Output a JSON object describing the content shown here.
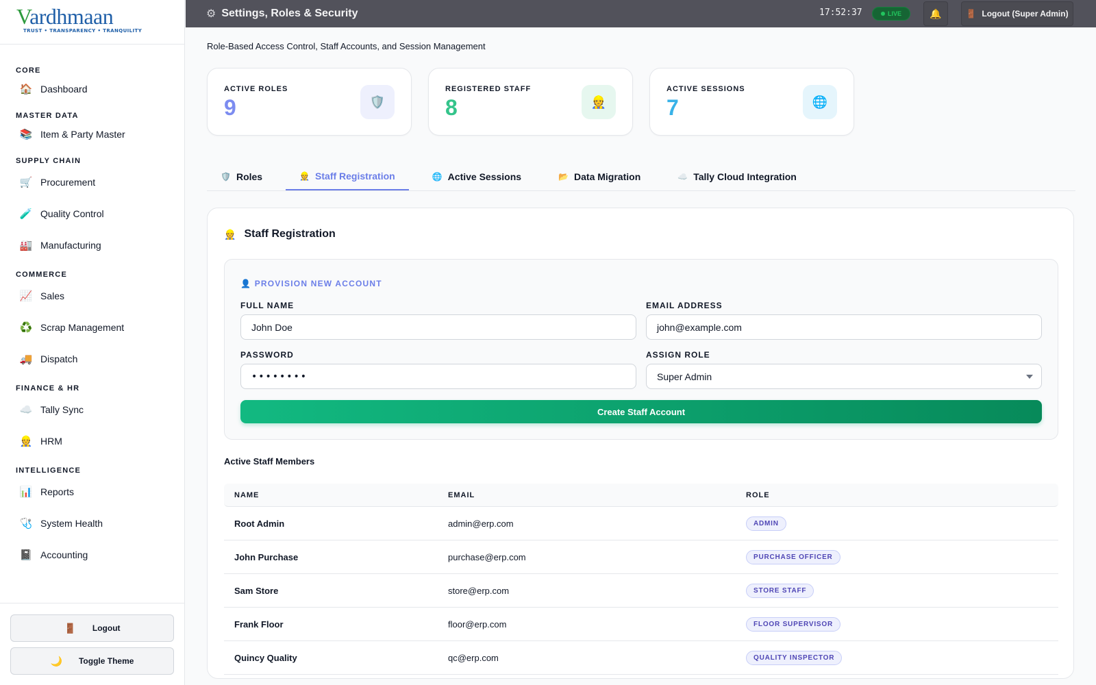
{
  "brand": {
    "name_first": "V",
    "name_rest": "ardhmaan",
    "tagline": "TRUST • TRANSPARENCY • TRANQUILITY"
  },
  "sidebar": {
    "sections": [
      {
        "title": "CORE",
        "items": [
          {
            "icon": "🏠",
            "icon_name": "home-icon",
            "label": "Dashboard"
          }
        ]
      },
      {
        "title": "MASTER DATA",
        "items": [
          {
            "icon": "📚",
            "icon_name": "books-icon",
            "label": "Item & Party Master"
          }
        ]
      },
      {
        "title": "SUPPLY CHAIN",
        "items": [
          {
            "icon": "🛒",
            "icon_name": "cart-icon",
            "label": "Procurement"
          },
          {
            "icon": "🧪",
            "icon_name": "test-tube-icon",
            "label": "Quality Control"
          },
          {
            "icon": "🏭",
            "icon_name": "factory-icon",
            "label": "Manufacturing"
          }
        ]
      },
      {
        "title": "COMMERCE",
        "items": [
          {
            "icon": "📈",
            "icon_name": "chart-up-icon",
            "label": "Sales"
          },
          {
            "icon": "♻️",
            "icon_name": "recycle-icon",
            "label": "Scrap Management"
          },
          {
            "icon": "🚚",
            "icon_name": "truck-icon",
            "label": "Dispatch"
          }
        ]
      },
      {
        "title": "FINANCE & HR",
        "items": [
          {
            "icon": "☁️",
            "icon_name": "cloud-icon",
            "label": "Tally Sync"
          },
          {
            "icon": "👷",
            "icon_name": "worker-icon",
            "label": "HRM"
          }
        ]
      },
      {
        "title": "INTELLIGENCE",
        "items": [
          {
            "icon": "📊",
            "icon_name": "bar-chart-icon",
            "label": "Reports"
          },
          {
            "icon": "🩺",
            "icon_name": "stethoscope-icon",
            "label": "System Health"
          },
          {
            "icon": "📓",
            "icon_name": "notebook-icon",
            "label": "Accounting"
          }
        ]
      }
    ],
    "logout_label": "Logout",
    "logout_icon": "🚪",
    "theme_label": "Toggle Theme",
    "theme_icon": "🌙"
  },
  "header": {
    "icon": "⚙",
    "title": "Settings, Roles & Security",
    "clock": "17:52:37",
    "live_label": "LIVE",
    "bell_icon": "🔔",
    "logout_icon": "🚪",
    "logout_label": "Logout (Super Admin)"
  },
  "page": {
    "subtitle": "Role-Based Access Control, Staff Accounts, and Session Management",
    "stats": [
      {
        "label": "ACTIVE ROLES",
        "value": "9",
        "icon": "🛡️",
        "icon_name": "shield-icon",
        "color": "#7c8cf0",
        "bg": "#eef0fd"
      },
      {
        "label": "REGISTERED STAFF",
        "value": "8",
        "icon": "👷",
        "icon_name": "staff-icon",
        "color": "#34c48b",
        "bg": "#e6f7ef"
      },
      {
        "label": "ACTIVE SESSIONS",
        "value": "7",
        "icon": "🌐",
        "icon_name": "globe-icon",
        "color": "#38b2e8",
        "bg": "#e5f5fc"
      }
    ],
    "tabs": [
      {
        "icon": "🛡️",
        "icon_name": "shield-icon",
        "label": "Roles",
        "active": false
      },
      {
        "icon": "👷",
        "icon_name": "staff-icon",
        "label": "Staff Registration",
        "active": true
      },
      {
        "icon": "🌐",
        "icon_name": "globe-icon",
        "label": "Active Sessions",
        "active": false
      },
      {
        "icon": "📂",
        "icon_name": "folder-icon",
        "label": "Data Migration",
        "active": false
      },
      {
        "icon": "☁️",
        "icon_name": "cloud-icon",
        "label": "Tally Cloud Integration",
        "active": false
      }
    ]
  },
  "panel": {
    "icon": "👷",
    "title": "Staff Registration",
    "form": {
      "section_icon": "👤",
      "section_label": "PROVISION NEW ACCOUNT",
      "full_name_label": "FULL NAME",
      "full_name_placeholder": "John Doe",
      "email_label": "EMAIL ADDRESS",
      "email_placeholder": "john@example.com",
      "password_label": "PASSWORD",
      "password_value": "••••••••",
      "role_label": "ASSIGN ROLE",
      "role_value": "Super Admin",
      "submit_label": "Create Staff Account"
    },
    "table": {
      "title": "Active Staff Members",
      "columns": [
        "NAME",
        "EMAIL",
        "ROLE"
      ],
      "rows": [
        {
          "name": "Root Admin",
          "email": "admin@erp.com",
          "role": "ADMIN"
        },
        {
          "name": "John Purchase",
          "email": "purchase@erp.com",
          "role": "PURCHASE OFFICER"
        },
        {
          "name": "Sam Store",
          "email": "store@erp.com",
          "role": "STORE STAFF"
        },
        {
          "name": "Frank Floor",
          "email": "floor@erp.com",
          "role": "FLOOR SUPERVISOR"
        },
        {
          "name": "Quincy Quality",
          "email": "qc@erp.com",
          "role": "QUALITY INSPECTOR"
        }
      ]
    }
  }
}
